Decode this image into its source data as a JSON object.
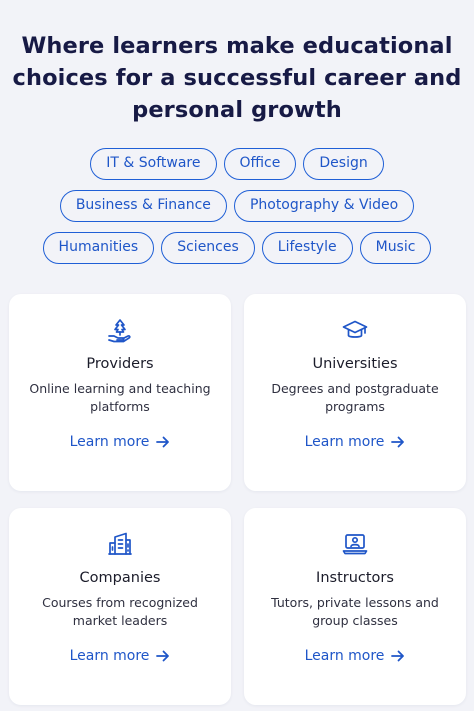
{
  "headline": "Where learners make educational choices for a successful career and personal growth",
  "headline_lines": [
    "Where learners make educational",
    "choices for a successful career and",
    "personal growth"
  ],
  "tags": {
    "row1": [
      "IT & Software",
      "Office",
      "Design"
    ],
    "row2": [
      "Business & Finance",
      "Photography & Video"
    ],
    "row3": [
      "Humanities",
      "Sciences",
      "Lifestyle",
      "Music"
    ]
  },
  "cards": [
    {
      "icon": "hand-plant-icon",
      "title": "Providers",
      "desc": [
        "Online learning and teaching",
        "platforms"
      ],
      "link": "Learn more"
    },
    {
      "icon": "graduation-cap-icon",
      "title": "Universities",
      "desc": [
        "Degrees and postgraduate",
        "programs"
      ],
      "link": "Learn more"
    },
    {
      "icon": "building-icon",
      "title": "Companies",
      "desc": [
        "Courses from recognized",
        "market leaders"
      ],
      "link": "Learn more"
    },
    {
      "icon": "instructor-laptop-icon",
      "title": "Instructors",
      "desc": [
        "Tutors, private lessons and",
        "group classes"
      ],
      "link": "Learn more"
    }
  ],
  "colors": {
    "accent": "#1f56c8",
    "background": "#f2f3f8",
    "card": "#ffffff",
    "headline": "#171a45"
  }
}
